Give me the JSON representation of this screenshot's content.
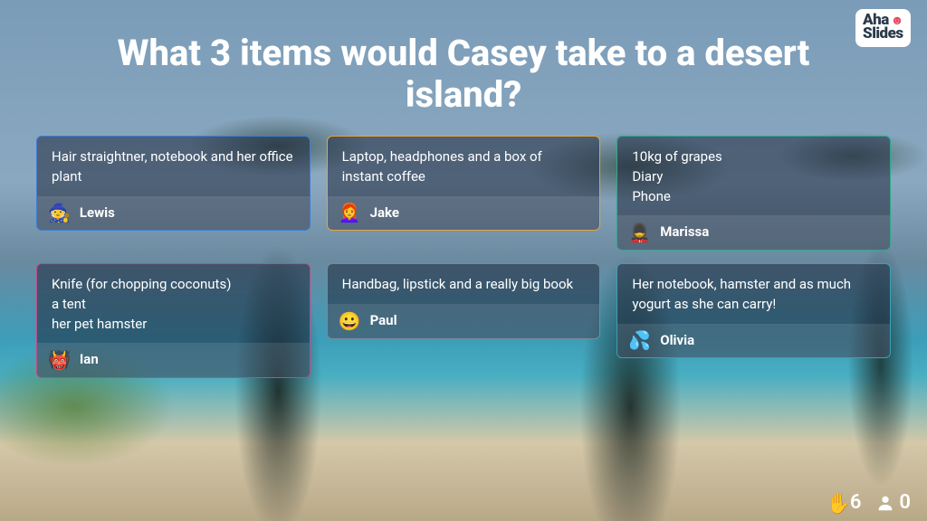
{
  "logo": {
    "top": "Aha",
    "bottom": "Slides"
  },
  "question": "What 3 items would Casey take to a desert island?",
  "cards": [
    {
      "text": "Hair straightner, notebook and her office plant",
      "author": "Lewis",
      "avatar": "🧙",
      "border": "#3d7ed6"
    },
    {
      "text": "Laptop, headphones and a box of instant coffee",
      "author": "Jake",
      "avatar": "👩‍🦰",
      "border": "#e8a23d"
    },
    {
      "text": "10kg of grapes\nDiary\nPhone",
      "author": "Marissa",
      "avatar": "💂",
      "border": "#2fa88a"
    },
    {
      "text": "Knife (for chopping coconuts)\na tent\nher pet hamster",
      "author": "Ian",
      "avatar": "👹",
      "border": "#c24a8a"
    },
    {
      "text": "Handbag, lipstick and a really big book",
      "author": "Paul",
      "avatar": "😀",
      "border": "#7a8a9a"
    },
    {
      "text": "Her notebook, hamster and as much yogurt as she can carry!",
      "author": "Olivia",
      "avatar": "💦",
      "border": "#3aa0b4"
    }
  ],
  "status": {
    "hands_raised": "6",
    "participants": "0"
  }
}
